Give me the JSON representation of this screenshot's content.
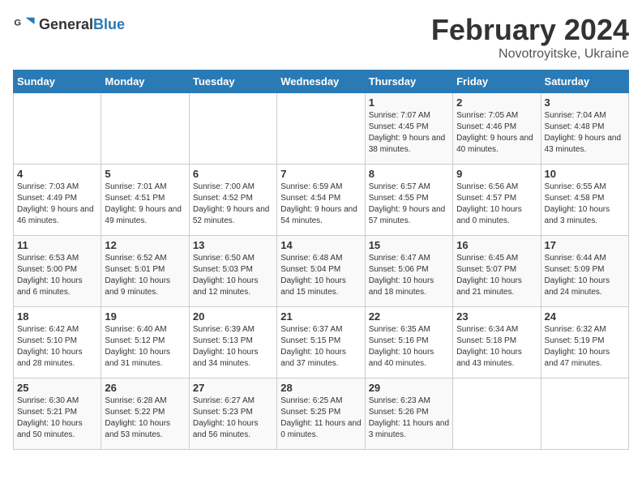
{
  "header": {
    "logo_general": "General",
    "logo_blue": "Blue",
    "title": "February 2024",
    "subtitle": "Novotroyitske, Ukraine"
  },
  "days_of_week": [
    "Sunday",
    "Monday",
    "Tuesday",
    "Wednesday",
    "Thursday",
    "Friday",
    "Saturday"
  ],
  "weeks": [
    [
      {
        "day": "",
        "sunrise": "",
        "sunset": "",
        "daylight": "",
        "empty": true
      },
      {
        "day": "",
        "sunrise": "",
        "sunset": "",
        "daylight": "",
        "empty": true
      },
      {
        "day": "",
        "sunrise": "",
        "sunset": "",
        "daylight": "",
        "empty": true
      },
      {
        "day": "",
        "sunrise": "",
        "sunset": "",
        "daylight": "",
        "empty": true
      },
      {
        "day": "1",
        "sunrise": "Sunrise: 7:07 AM",
        "sunset": "Sunset: 4:45 PM",
        "daylight": "Daylight: 9 hours and 38 minutes.",
        "empty": false
      },
      {
        "day": "2",
        "sunrise": "Sunrise: 7:05 AM",
        "sunset": "Sunset: 4:46 PM",
        "daylight": "Daylight: 9 hours and 40 minutes.",
        "empty": false
      },
      {
        "day": "3",
        "sunrise": "Sunrise: 7:04 AM",
        "sunset": "Sunset: 4:48 PM",
        "daylight": "Daylight: 9 hours and 43 minutes.",
        "empty": false
      }
    ],
    [
      {
        "day": "4",
        "sunrise": "Sunrise: 7:03 AM",
        "sunset": "Sunset: 4:49 PM",
        "daylight": "Daylight: 9 hours and 46 minutes.",
        "empty": false
      },
      {
        "day": "5",
        "sunrise": "Sunrise: 7:01 AM",
        "sunset": "Sunset: 4:51 PM",
        "daylight": "Daylight: 9 hours and 49 minutes.",
        "empty": false
      },
      {
        "day": "6",
        "sunrise": "Sunrise: 7:00 AM",
        "sunset": "Sunset: 4:52 PM",
        "daylight": "Daylight: 9 hours and 52 minutes.",
        "empty": false
      },
      {
        "day": "7",
        "sunrise": "Sunrise: 6:59 AM",
        "sunset": "Sunset: 4:54 PM",
        "daylight": "Daylight: 9 hours and 54 minutes.",
        "empty": false
      },
      {
        "day": "8",
        "sunrise": "Sunrise: 6:57 AM",
        "sunset": "Sunset: 4:55 PM",
        "daylight": "Daylight: 9 hours and 57 minutes.",
        "empty": false
      },
      {
        "day": "9",
        "sunrise": "Sunrise: 6:56 AM",
        "sunset": "Sunset: 4:57 PM",
        "daylight": "Daylight: 10 hours and 0 minutes.",
        "empty": false
      },
      {
        "day": "10",
        "sunrise": "Sunrise: 6:55 AM",
        "sunset": "Sunset: 4:58 PM",
        "daylight": "Daylight: 10 hours and 3 minutes.",
        "empty": false
      }
    ],
    [
      {
        "day": "11",
        "sunrise": "Sunrise: 6:53 AM",
        "sunset": "Sunset: 5:00 PM",
        "daylight": "Daylight: 10 hours and 6 minutes.",
        "empty": false
      },
      {
        "day": "12",
        "sunrise": "Sunrise: 6:52 AM",
        "sunset": "Sunset: 5:01 PM",
        "daylight": "Daylight: 10 hours and 9 minutes.",
        "empty": false
      },
      {
        "day": "13",
        "sunrise": "Sunrise: 6:50 AM",
        "sunset": "Sunset: 5:03 PM",
        "daylight": "Daylight: 10 hours and 12 minutes.",
        "empty": false
      },
      {
        "day": "14",
        "sunrise": "Sunrise: 6:48 AM",
        "sunset": "Sunset: 5:04 PM",
        "daylight": "Daylight: 10 hours and 15 minutes.",
        "empty": false
      },
      {
        "day": "15",
        "sunrise": "Sunrise: 6:47 AM",
        "sunset": "Sunset: 5:06 PM",
        "daylight": "Daylight: 10 hours and 18 minutes.",
        "empty": false
      },
      {
        "day": "16",
        "sunrise": "Sunrise: 6:45 AM",
        "sunset": "Sunset: 5:07 PM",
        "daylight": "Daylight: 10 hours and 21 minutes.",
        "empty": false
      },
      {
        "day": "17",
        "sunrise": "Sunrise: 6:44 AM",
        "sunset": "Sunset: 5:09 PM",
        "daylight": "Daylight: 10 hours and 24 minutes.",
        "empty": false
      }
    ],
    [
      {
        "day": "18",
        "sunrise": "Sunrise: 6:42 AM",
        "sunset": "Sunset: 5:10 PM",
        "daylight": "Daylight: 10 hours and 28 minutes.",
        "empty": false
      },
      {
        "day": "19",
        "sunrise": "Sunrise: 6:40 AM",
        "sunset": "Sunset: 5:12 PM",
        "daylight": "Daylight: 10 hours and 31 minutes.",
        "empty": false
      },
      {
        "day": "20",
        "sunrise": "Sunrise: 6:39 AM",
        "sunset": "Sunset: 5:13 PM",
        "daylight": "Daylight: 10 hours and 34 minutes.",
        "empty": false
      },
      {
        "day": "21",
        "sunrise": "Sunrise: 6:37 AM",
        "sunset": "Sunset: 5:15 PM",
        "daylight": "Daylight: 10 hours and 37 minutes.",
        "empty": false
      },
      {
        "day": "22",
        "sunrise": "Sunrise: 6:35 AM",
        "sunset": "Sunset: 5:16 PM",
        "daylight": "Daylight: 10 hours and 40 minutes.",
        "empty": false
      },
      {
        "day": "23",
        "sunrise": "Sunrise: 6:34 AM",
        "sunset": "Sunset: 5:18 PM",
        "daylight": "Daylight: 10 hours and 43 minutes.",
        "empty": false
      },
      {
        "day": "24",
        "sunrise": "Sunrise: 6:32 AM",
        "sunset": "Sunset: 5:19 PM",
        "daylight": "Daylight: 10 hours and 47 minutes.",
        "empty": false
      }
    ],
    [
      {
        "day": "25",
        "sunrise": "Sunrise: 6:30 AM",
        "sunset": "Sunset: 5:21 PM",
        "daylight": "Daylight: 10 hours and 50 minutes.",
        "empty": false
      },
      {
        "day": "26",
        "sunrise": "Sunrise: 6:28 AM",
        "sunset": "Sunset: 5:22 PM",
        "daylight": "Daylight: 10 hours and 53 minutes.",
        "empty": false
      },
      {
        "day": "27",
        "sunrise": "Sunrise: 6:27 AM",
        "sunset": "Sunset: 5:23 PM",
        "daylight": "Daylight: 10 hours and 56 minutes.",
        "empty": false
      },
      {
        "day": "28",
        "sunrise": "Sunrise: 6:25 AM",
        "sunset": "Sunset: 5:25 PM",
        "daylight": "Daylight: 11 hours and 0 minutes.",
        "empty": false
      },
      {
        "day": "29",
        "sunrise": "Sunrise: 6:23 AM",
        "sunset": "Sunset: 5:26 PM",
        "daylight": "Daylight: 11 hours and 3 minutes.",
        "empty": false
      },
      {
        "day": "",
        "sunrise": "",
        "sunset": "",
        "daylight": "",
        "empty": true
      },
      {
        "day": "",
        "sunrise": "",
        "sunset": "",
        "daylight": "",
        "empty": true
      }
    ]
  ]
}
